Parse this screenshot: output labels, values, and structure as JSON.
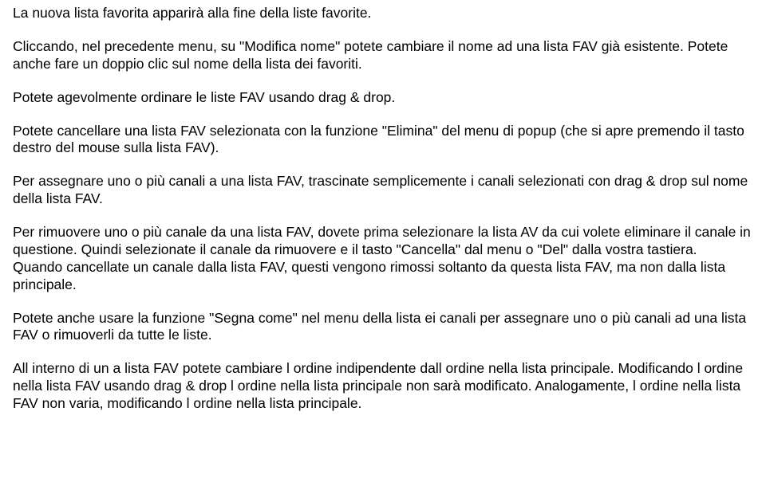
{
  "doc": {
    "p1": "La nuova lista favorita apparirà alla fine della liste favorite.",
    "p2": "Cliccando, nel precedente menu, su \"Modifica nome\" potete cambiare il nome ad una lista FAV già esistente. Potete anche fare un doppio clic sul nome della lista dei favoriti.",
    "p3": "Potete agevolmente ordinare le liste FAV usando drag & drop.",
    "p4": "Potete cancellare una lista FAV selezionata con la funzione \"Elimina\" del menu di popup (che si apre premendo il tasto destro del mouse sulla lista FAV).",
    "p5": "Per assegnare uno o più canali a una lista FAV, trascinate semplicemente i canali selezionati con drag & drop sul nome della lista FAV.",
    "p6a": "Per rimuovere uno o più canale da una lista FAV, dovete prima selezionare la lista AV da cui volete eliminare il canale in questione. Quindi selezionate il canale da rimuovere e il tasto \"Cancella\" dal menu o \"Del\" dalla vostra tastiera.",
    "p6b": "Quando cancellate un canale dalla lista FAV, questi vengono rimossi soltanto da questa lista FAV, ma non dalla lista principale.",
    "p7": "Potete anche usare la funzione \"Segna come\" nel menu della lista ei canali per assegnare uno o più canali ad una lista FAV o rimuoverli da tutte le liste.",
    "p8": "All interno di un a lista FAV potete cambiare l ordine indipendente dall ordine nella lista principale. Modificando l ordine nella lista FAV usando drag & drop l ordine nella lista principale non sarà modificato. Analogamente, l ordine nella lista FAV non varia, modificando l ordine nella lista principale."
  }
}
